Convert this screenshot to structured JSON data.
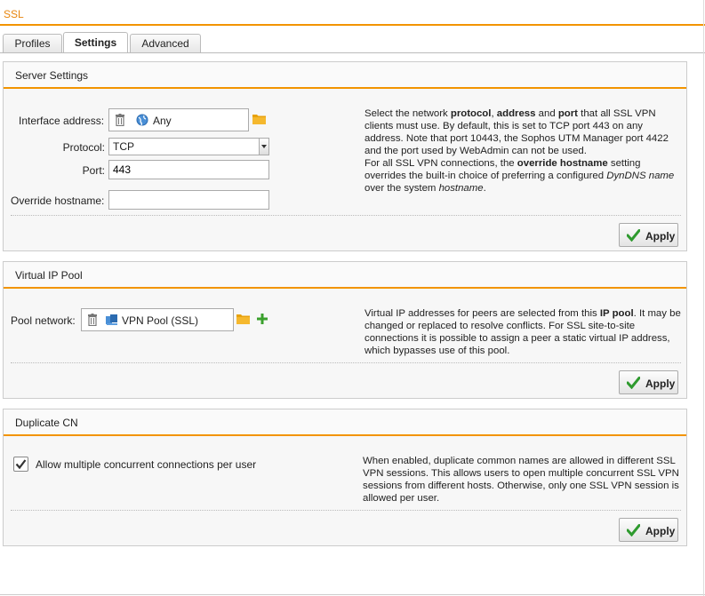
{
  "page": {
    "title": "SSL"
  },
  "tabs": [
    {
      "label": "Profiles",
      "active": false
    },
    {
      "label": "Settings",
      "active": true
    },
    {
      "label": "Advanced",
      "active": false
    }
  ],
  "server_settings": {
    "title": "Server Settings",
    "interface_label": "Interface address:",
    "interface_value": "Any",
    "protocol_label": "Protocol:",
    "protocol_value": "TCP",
    "port_label": "Port:",
    "port_value": "443",
    "override_label": "Override hostname:",
    "override_value": "",
    "help": {
      "p1": "Select the network ",
      "b1": "protocol",
      "p2": ", ",
      "b2": "address",
      "p3": " and ",
      "b3": "port",
      "p4": " that all SSL VPN clients must use. By default, this is set to TCP port 443 on any address. Note that port 10443, the Sophos UTM Manager port 4422 and the port used by WebAdmin can not be used.",
      "p5": "For all SSL VPN connections, the ",
      "b4": "override hostname",
      "p6": " setting overrides the built-in choice of preferring a configured ",
      "i1": "DynDNS name",
      "p7": " over the system ",
      "i2": "hostname",
      "p8": "."
    },
    "apply_label": "Apply"
  },
  "virtual_ip_pool": {
    "title": "Virtual IP Pool",
    "pool_label": "Pool network:",
    "pool_value": "VPN Pool (SSL)",
    "help": {
      "p1": "Virtual IP addresses for peers are selected from this ",
      "b1": "IP pool",
      "p2": ". It may be changed or replaced to resolve conflicts. For SSL site-to-site connections it is possible to assign a peer a static virtual IP address, which bypasses use of this pool."
    },
    "apply_label": "Apply"
  },
  "duplicate_cn": {
    "title": "Duplicate CN",
    "checkbox_label": "Allow multiple concurrent connections per user",
    "checked": true,
    "help": "When enabled, duplicate common names are allowed in different SSL VPN sessions. This allows users to open multiple concurrent SSL VPN sessions from different hosts. Otherwise, only one SSL VPN session is allowed per user.",
    "apply_label": "Apply"
  },
  "colors": {
    "accent": "#f29400",
    "title": "#e8850c",
    "plus": "#3aa02c",
    "check": "#2e9a2e"
  },
  "icons": [
    "trash-icon",
    "globe-icon",
    "network-icon",
    "folder-icon",
    "plus-icon",
    "check-icon"
  ]
}
